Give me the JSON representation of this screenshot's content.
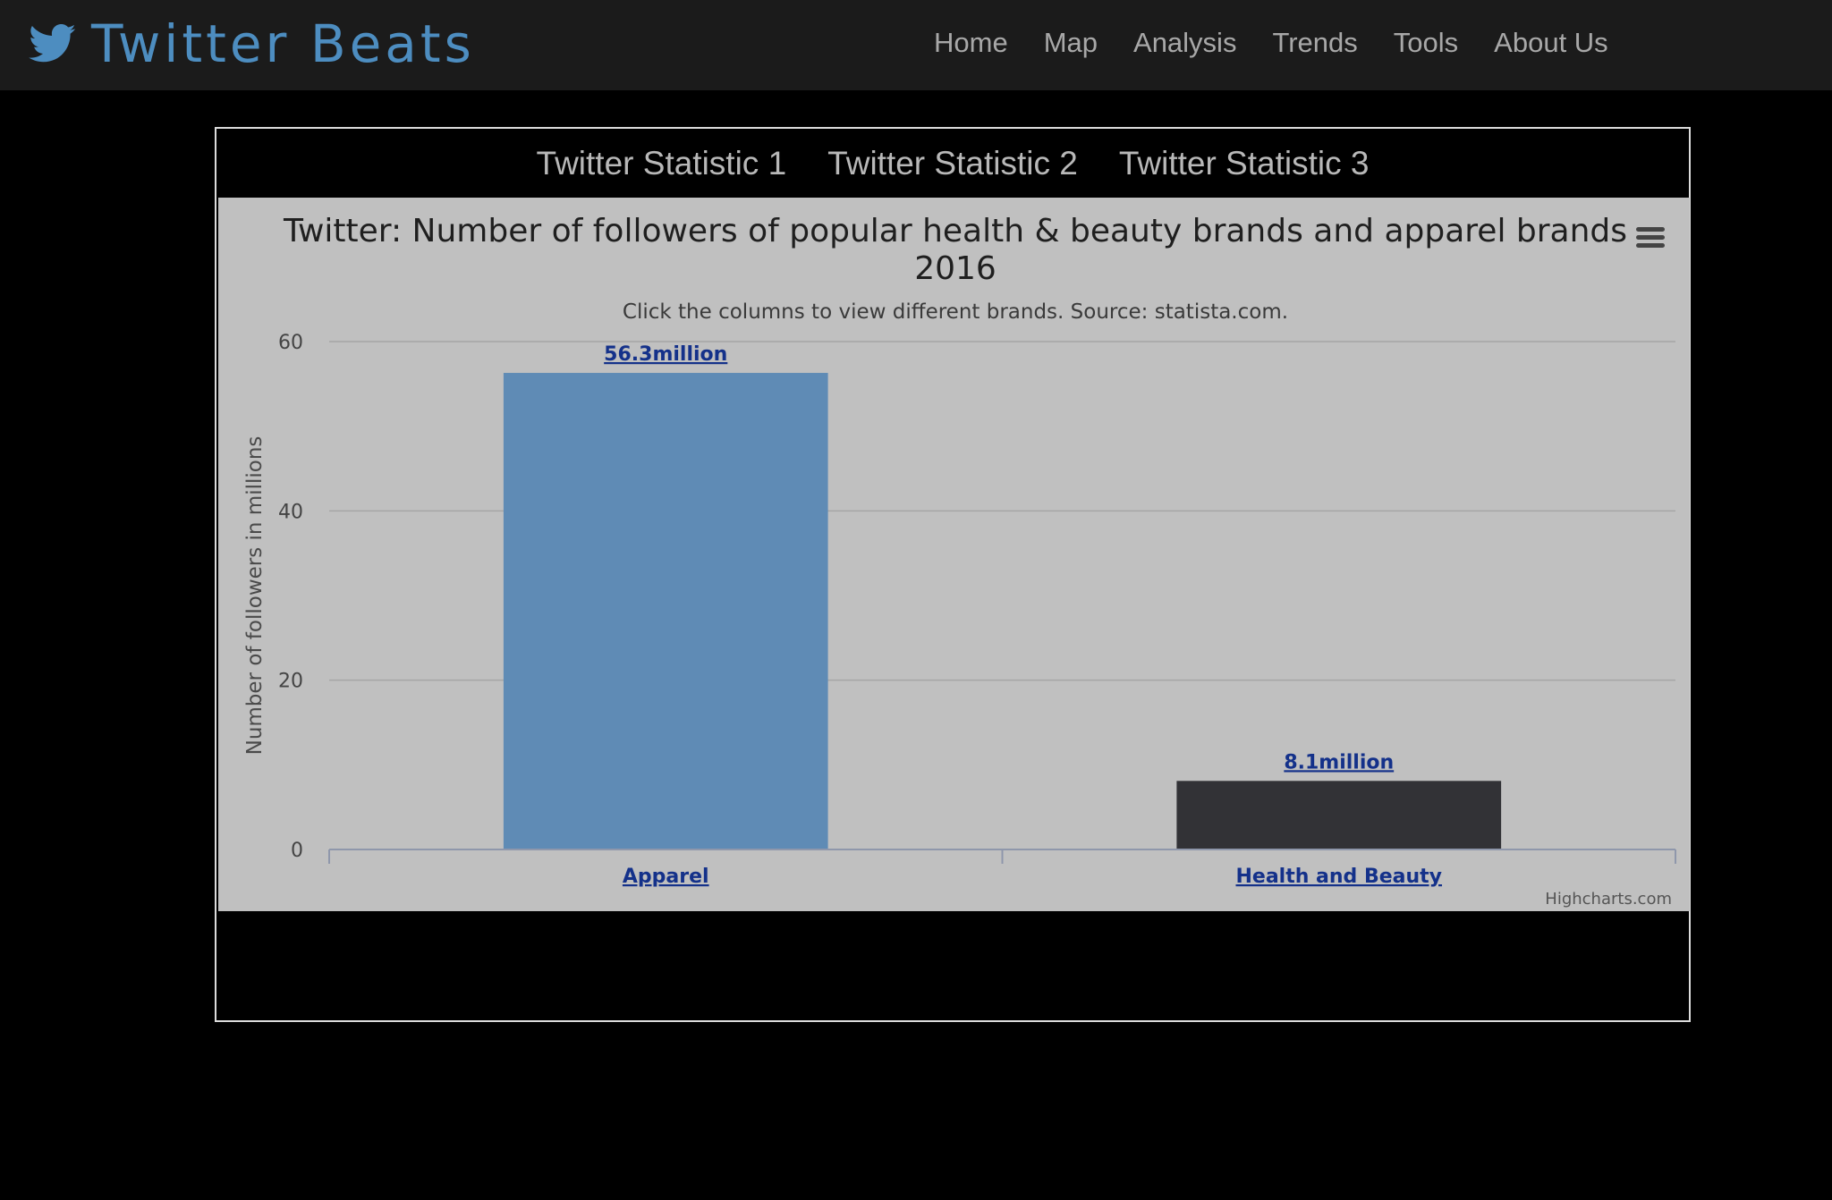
{
  "header": {
    "brand": "Twitter Beats",
    "brand_color": "#4d8dc0",
    "logo_icon": "twitter-bird-icon",
    "nav": [
      "Home",
      "Map",
      "Analysis",
      "Trends",
      "Tools",
      "About Us"
    ]
  },
  "panel": {
    "tabs": [
      "Twitter Statistic 1",
      "Twitter Statistic 2",
      "Twitter Statistic 3"
    ]
  },
  "chart_data": {
    "type": "bar",
    "title_lines": [
      "Twitter: Number of followers of popular health & beauty brands and apparel brands",
      "2016"
    ],
    "subtitle": "Click the columns to view different brands. Source: statista.com.",
    "ylabel": "Number of followers in millions",
    "xlabel": "",
    "categories": [
      "Apparel",
      "Health and Beauty"
    ],
    "values": [
      56.3,
      8.1
    ],
    "data_labels": [
      "56.3million",
      "8.1million"
    ],
    "colors": [
      "#5f8bb5",
      "#323236"
    ],
    "ylim": [
      0,
      60
    ],
    "yticks": [
      0,
      20,
      40,
      60
    ],
    "ytick_labels": [
      "0",
      "20",
      "40",
      "60"
    ],
    "grid": true,
    "legend": "none",
    "menu_icon": "hamburger-menu-icon",
    "credits": "Highcharts.com"
  }
}
